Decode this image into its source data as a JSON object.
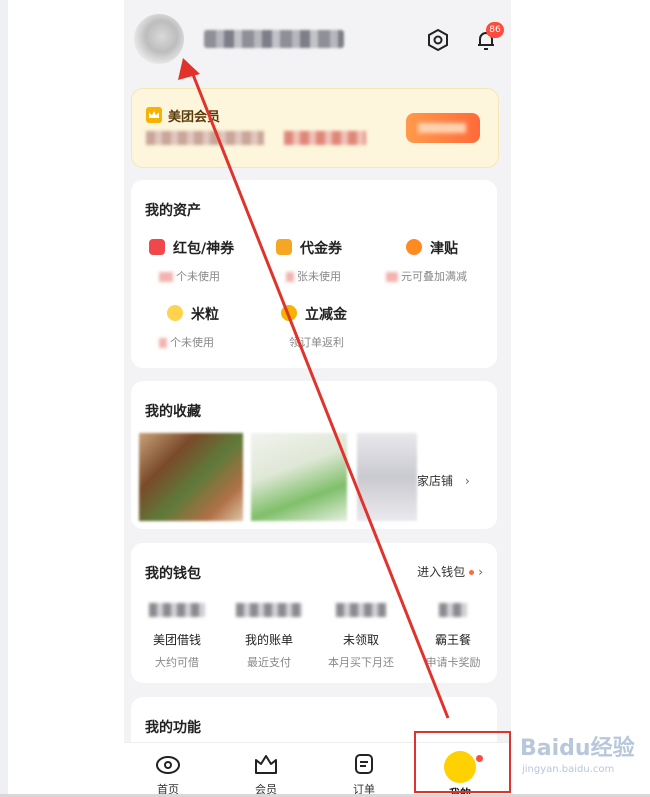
{
  "header": {
    "notification_count": "86"
  },
  "member": {
    "title": "美团会员"
  },
  "assets": {
    "title": "我的资产",
    "items": [
      {
        "label": "红包/神券",
        "sub": "个未使用",
        "color": "#f0484a"
      },
      {
        "label": "代金券",
        "sub": "张未使用",
        "color": "#f5a623"
      },
      {
        "label": "津贴",
        "sub": "元可叠加满减",
        "color": "#ff8a1f"
      },
      {
        "label": "米粒",
        "sub": "个未使用",
        "color": "#ffd34d"
      },
      {
        "label": "立减金",
        "sub": "领订单返利",
        "color": "#f5b400"
      }
    ]
  },
  "favorites": {
    "title": "我的收藏",
    "store_text": "家店铺"
  },
  "wallet": {
    "title": "我的钱包",
    "link": "进入钱包",
    "items": [
      {
        "label": "美团借钱",
        "sub": "大约可借"
      },
      {
        "label": "我的账单",
        "sub": "最近支付"
      },
      {
        "label": "未领取",
        "sub": "本月买下月还"
      },
      {
        "label": "霸王餐",
        "sub": "申请卡奖励"
      }
    ]
  },
  "functions": {
    "title": "我的功能"
  },
  "tabbar": {
    "items": [
      {
        "label": "首页"
      },
      {
        "label": "会员"
      },
      {
        "label": "订单"
      },
      {
        "label": "我的"
      }
    ]
  },
  "watermark": {
    "brand": "Baidu经验",
    "url": "jingyan.baidu.com"
  },
  "colors": {
    "accent": "#ffd100",
    "annotation": "#e0332c"
  }
}
